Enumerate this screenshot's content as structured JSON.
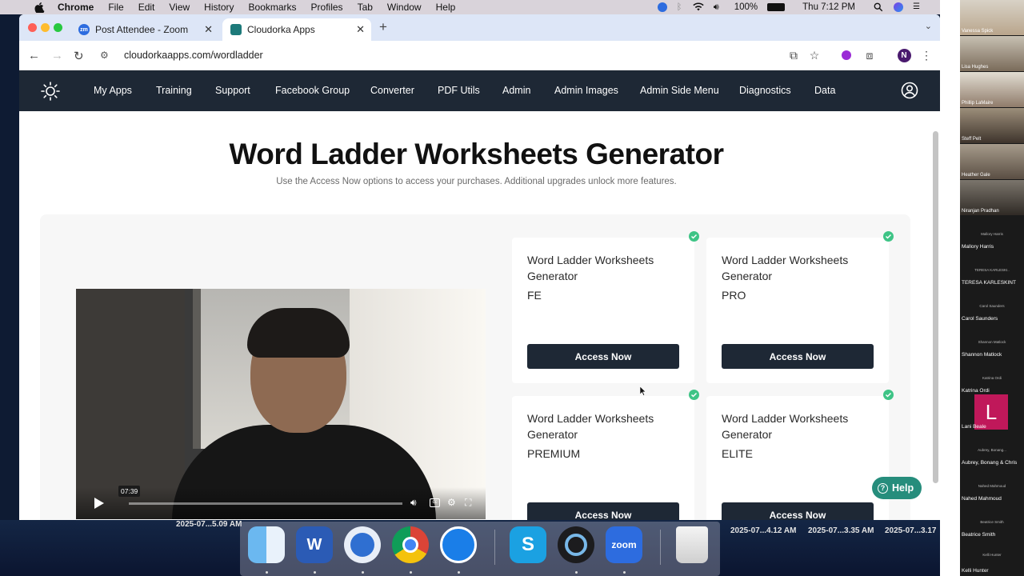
{
  "menubar": {
    "app": "Chrome",
    "items": [
      "File",
      "Edit",
      "View",
      "History",
      "Bookmarks",
      "Profiles",
      "Tab",
      "Window",
      "Help"
    ],
    "battery": "100%",
    "clock": "Thu 7:12 PM"
  },
  "browser": {
    "tabs": [
      {
        "title": "Post Attendee - Zoom",
        "favicon": "zm"
      },
      {
        "title": "Cloudorka Apps"
      }
    ],
    "url": "cloudorkaapps.com/wordladder",
    "profile_initial": "N"
  },
  "sitenav": {
    "items": [
      "My Apps",
      "Training",
      "Support",
      "Facebook Group",
      "Converter",
      "PDF Utils",
      "Admin",
      "Admin Images",
      "Admin Side Menu",
      "Diagnostics",
      "Data"
    ]
  },
  "page": {
    "title": "Word Ladder Worksheets Generator",
    "subtitle": "Use the Access Now options to access your purchases. Additional upgrades unlock more features."
  },
  "video": {
    "timestamp": "07:39"
  },
  "cards": [
    {
      "title": "Word Ladder Worksheets Generator",
      "tier": "FE",
      "button": "Access Now"
    },
    {
      "title": "Word Ladder Worksheets Generator",
      "tier": "PRO",
      "button": "Access Now"
    },
    {
      "title": "Word Ladder Worksheets Generator",
      "tier": "PREMIUM",
      "button": "Access Now"
    },
    {
      "title": "Word Ladder Worksheets Generator",
      "tier": "ELITE",
      "button": "Access Now"
    }
  ],
  "help_button": "Help",
  "desktop": {
    "screenshot_labels": [
      "2025-07...5.09 AM",
      "2025-07...4.12 AM",
      "2025-07...3.35 AM",
      "2025-07...3.17"
    ]
  },
  "zoom": {
    "video_participants": [
      "Vanessa Spick",
      "Lisa Hughes",
      "Phillip LaMaire",
      "Steff Pelt",
      "Heather Gale",
      "Niranjan Pradhan"
    ],
    "name_tiles": [
      {
        "top": "Mallory Harris",
        "name": "Mallory Harris"
      },
      {
        "top": "TERESA KARLESKI..",
        "name": "TERESA KARLESKINT"
      },
      {
        "top": "Carol Saunders",
        "name": "Carol Saunders"
      },
      {
        "top": "Shannon Matlock",
        "name": "Shannon Matlock"
      },
      {
        "top": "Katrina Ordi",
        "name": "Katrina Ordi"
      },
      {
        "top": "",
        "name": "Lani Beale"
      },
      {
        "top": "Aubrey, Bonang...",
        "name": "Aubrey, Bonang & Chris"
      },
      {
        "top": "Nahed Mahmoud",
        "name": "Nahed Mahmoud"
      },
      {
        "top": "Beatrice Smith",
        "name": "Beatrice Smith"
      },
      {
        "top": "Kelli Hunter",
        "name": "Kelli Hunter"
      }
    ],
    "lani_initial": "L"
  },
  "colors": {
    "nav_bg": "#1e2835",
    "button_bg": "#1e2835",
    "check_green": "#3ec486",
    "help_teal": "#268d7c"
  }
}
